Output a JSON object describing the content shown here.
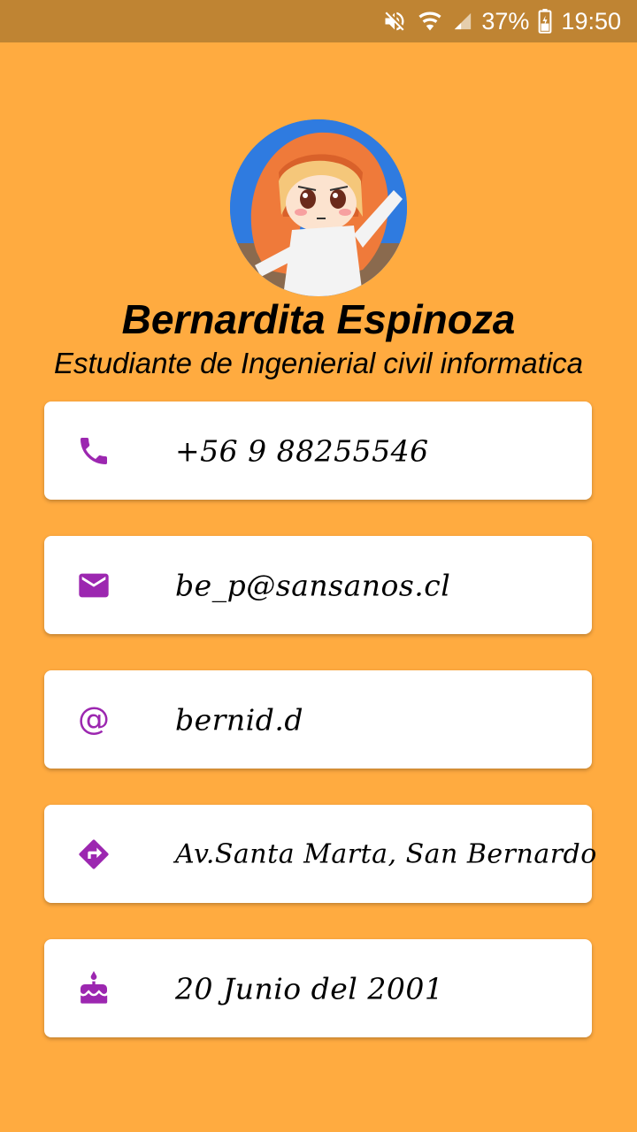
{
  "status_bar": {
    "battery_percent": "37%",
    "time": "19:50",
    "icons": [
      "mute-icon",
      "wifi-icon",
      "signal-icon",
      "battery-icon"
    ]
  },
  "profile": {
    "name": "Bernardita Espinoza",
    "subtitle": "Estudiante de Ingenierial civil informatica",
    "avatar": "anime-character-avatar"
  },
  "contacts": [
    {
      "icon": "phone-icon",
      "value": "+56 9 88255546"
    },
    {
      "icon": "email-icon",
      "value": "be_p@sansanos.cl"
    },
    {
      "icon": "at-sign-icon",
      "value": "bernid.d"
    },
    {
      "icon": "directions-icon",
      "value": "Av.Santa Marta, San Bernardo"
    },
    {
      "icon": "cake-icon",
      "value": "20 Junio del 2001"
    }
  ],
  "colors": {
    "background": "#FFAB40",
    "status_bar": "#BF8433",
    "icon_accent": "#9C27B0",
    "card": "#FFFFFF"
  }
}
